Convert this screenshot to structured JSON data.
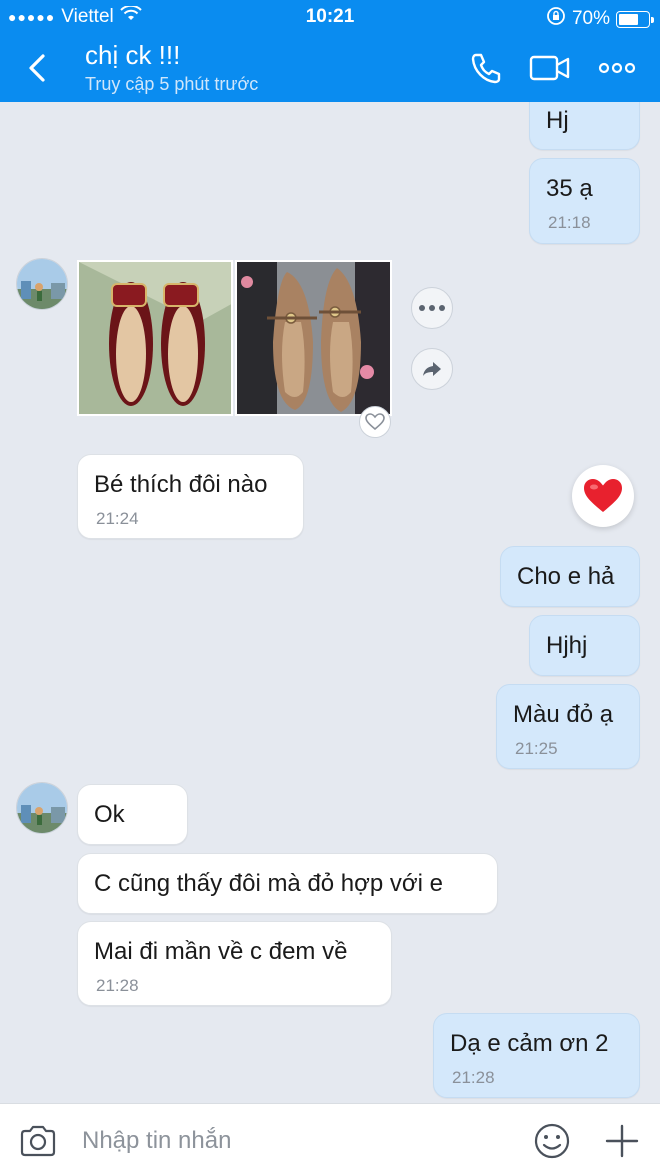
{
  "status_bar": {
    "carrier": "Viettel",
    "time": "10:21",
    "battery": "70%",
    "battery_level": 0.7
  },
  "header": {
    "contact_name": "chị ck !!!",
    "contact_status": "Truy cập 5 phút trước"
  },
  "messages": {
    "m1": {
      "text": "Hj"
    },
    "m2": {
      "text": "35 ạ",
      "time": "21:18"
    },
    "m3": {
      "text": "Bé thích đôi nào",
      "time": "21:24"
    },
    "m4": {
      "text": "Cho e hả"
    },
    "m5": {
      "text": "Hjhj"
    },
    "m6": {
      "text": "Màu đỏ ạ",
      "time": "21:25"
    },
    "m7": {
      "text": "Ok"
    },
    "m8": {
      "text": "C cũng thấy đôi mà đỏ hợp với e"
    },
    "m9": {
      "text": "Mai đi mần về c đem về",
      "time": "21:28"
    },
    "m10": {
      "text": "Dạ e cảm ơn 2",
      "time": "21:28"
    }
  },
  "input": {
    "placeholder": "Nhập tin nhắn"
  },
  "colors": {
    "header": "#0a8cf0",
    "outgoing_bubble": "#d4e8fb",
    "incoming_bubble": "#ffffff",
    "background": "#e5e9f0",
    "heart": "#e8212e"
  },
  "icons": [
    "back-icon",
    "phone-icon",
    "video-call-icon",
    "more-icon",
    "more-options-icon",
    "share-icon",
    "heart-icon",
    "camera-icon",
    "emoji-icon",
    "add-icon"
  ]
}
